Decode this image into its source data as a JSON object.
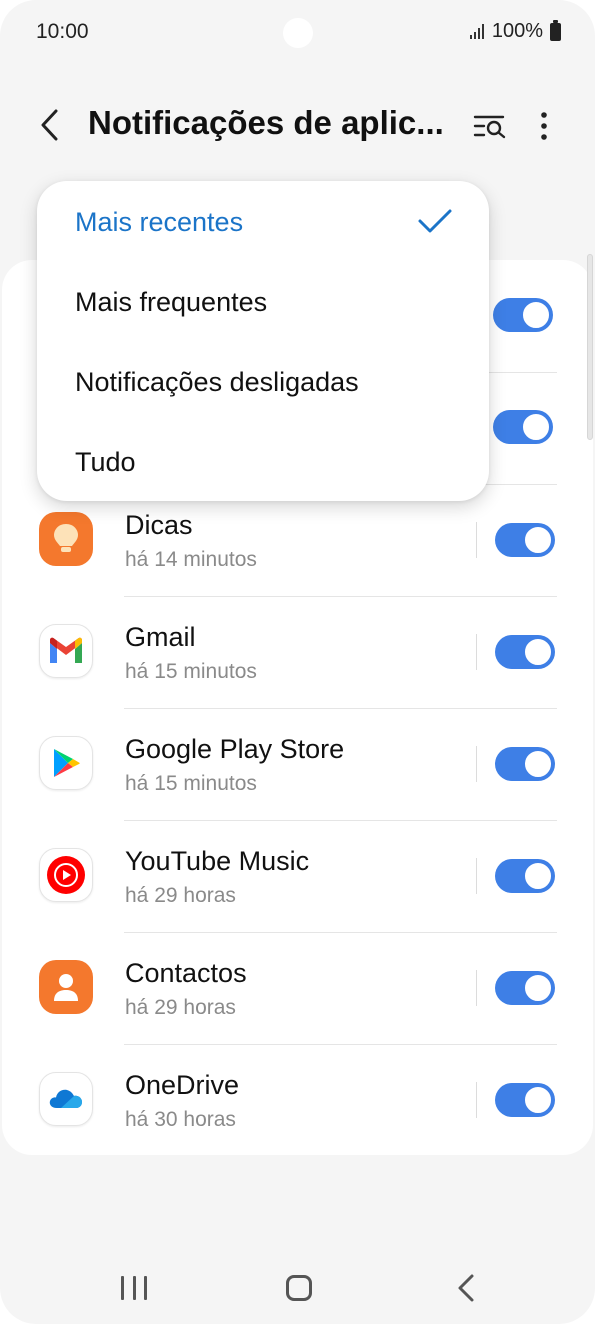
{
  "status_bar": {
    "time": "10:00",
    "battery": "100%"
  },
  "app_bar": {
    "title": "Notificações de aplic..."
  },
  "sort_menu": {
    "items": [
      {
        "label": "Mais recentes",
        "selected": true
      },
      {
        "label": "Mais frequentes",
        "selected": false
      },
      {
        "label": "Notificações desligadas",
        "selected": false
      },
      {
        "label": "Tudo",
        "selected": false
      }
    ]
  },
  "apps": [
    {
      "name": "Dicas",
      "time": "há 14 minutos",
      "icon": "dicas-bulb-icon",
      "enabled": true
    },
    {
      "name": "Gmail",
      "time": "há 15 minutos",
      "icon": "gmail-icon",
      "enabled": true
    },
    {
      "name": "Google Play Store",
      "time": "há 15 minutos",
      "icon": "google-play-icon",
      "enabled": true
    },
    {
      "name": "YouTube Music",
      "time": "há 29 horas",
      "icon": "youtube-music-icon",
      "enabled": true
    },
    {
      "name": "Contactos",
      "time": "há 29 horas",
      "icon": "contacts-icon",
      "enabled": true
    },
    {
      "name": "OneDrive",
      "time": "há 30 horas",
      "icon": "onedrive-icon",
      "enabled": true
    }
  ],
  "colors": {
    "accent": "#3e7fe6",
    "selected_text": "#1b74c8",
    "orange_icon": "#f4782d"
  }
}
